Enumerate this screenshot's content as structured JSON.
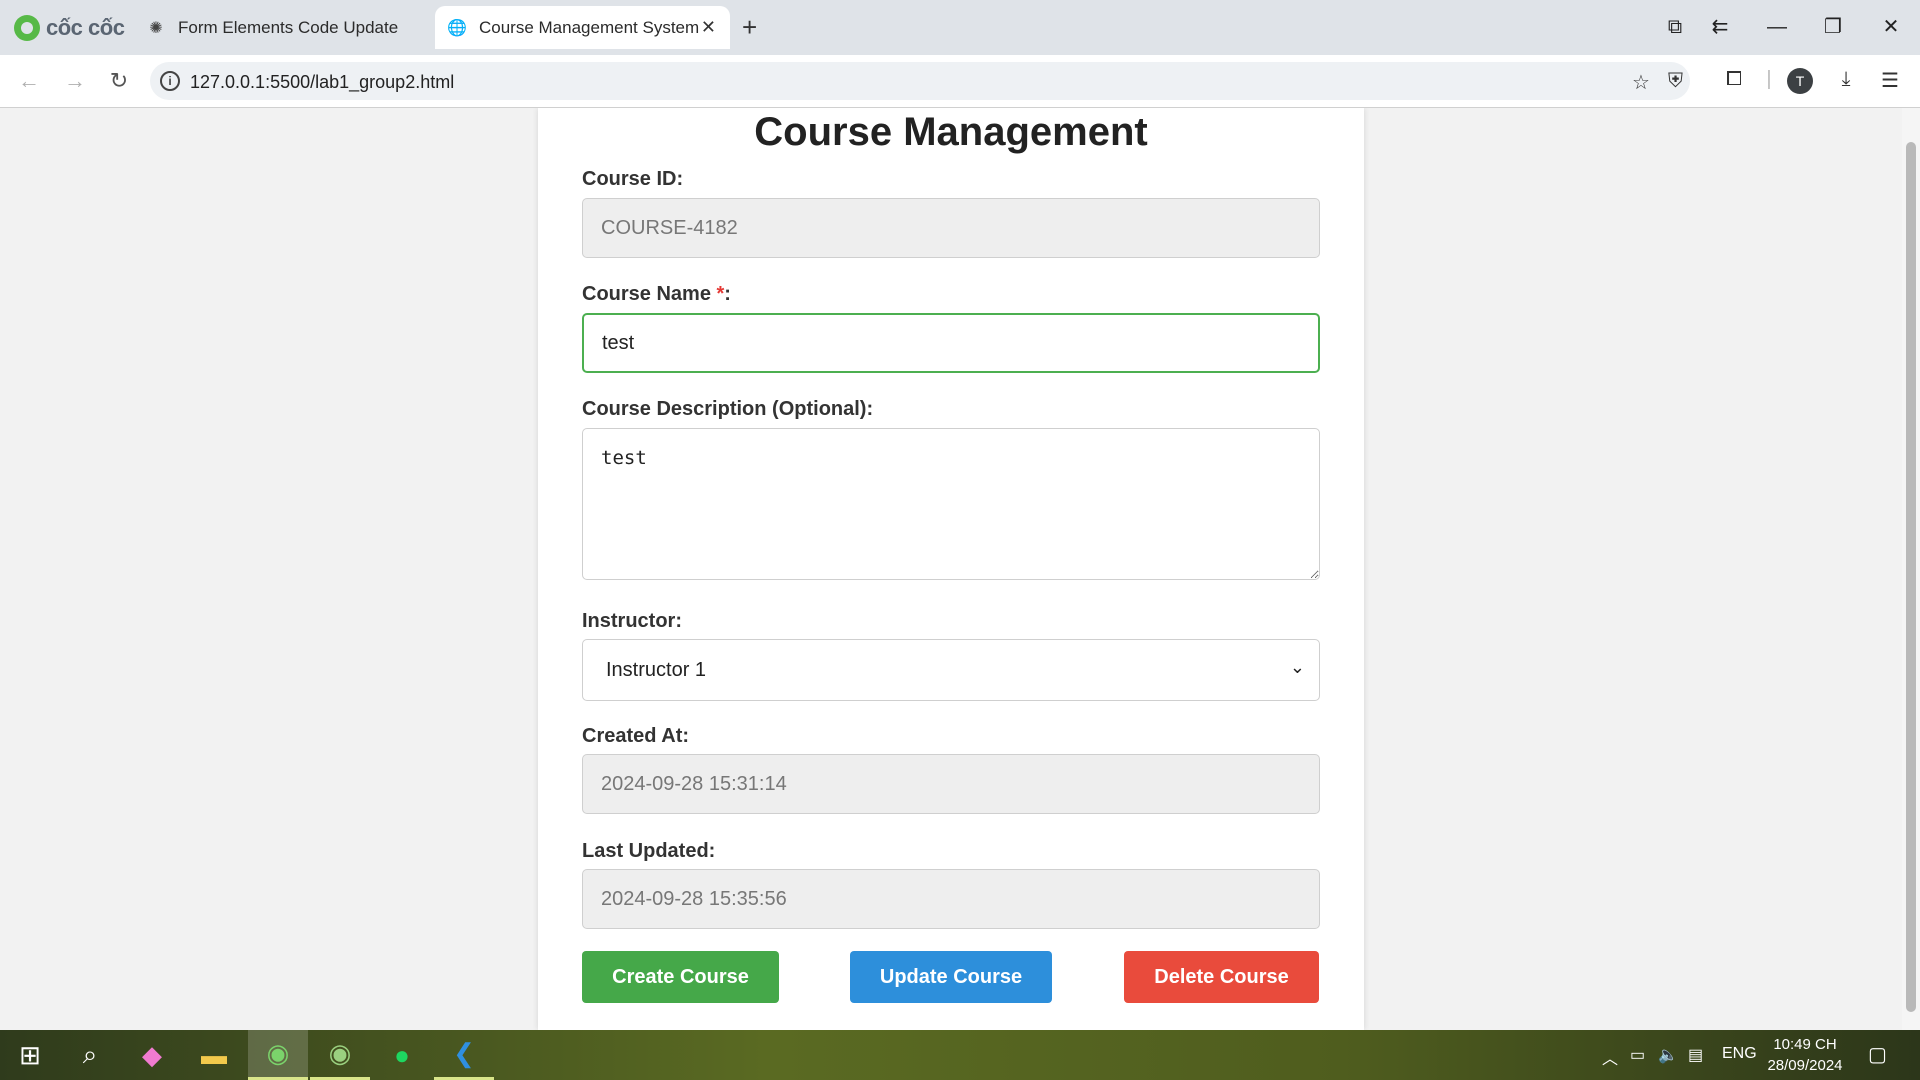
{
  "browser": {
    "brand": "cốc cốc",
    "tabs": [
      {
        "title": "Form Elements Code Update",
        "active": false
      },
      {
        "title": "Course Management System",
        "active": true
      }
    ],
    "url": "127.0.0.1:5500/lab1_group2.html",
    "profile_initial": "T"
  },
  "page": {
    "title": "Course Management",
    "course_id": {
      "label": "Course ID:",
      "value": "COURSE-4182"
    },
    "course_name": {
      "label": "Course Name ",
      "required_mark": "*",
      "label_suffix": ":",
      "value": "test"
    },
    "description": {
      "label": "Course Description (Optional):",
      "value": "test"
    },
    "instructor": {
      "label": "Instructor:",
      "selected": "Instructor 1"
    },
    "created_at": {
      "label": "Created At:",
      "value": "2024-09-28 15:31:14"
    },
    "last_updated": {
      "label": "Last Updated:",
      "value": "2024-09-28 15:35:56"
    },
    "buttons": {
      "create": "Create Course",
      "update": "Update Course",
      "delete": "Delete Course"
    }
  },
  "colors": {
    "create": "#45a849",
    "update": "#2d8fdb",
    "delete": "#e94b3c",
    "valid_border": "#4caf50",
    "required": "#e53935"
  },
  "taskbar": {
    "language": "ENG",
    "time": "10:49 CH",
    "date": "28/09/2024"
  }
}
